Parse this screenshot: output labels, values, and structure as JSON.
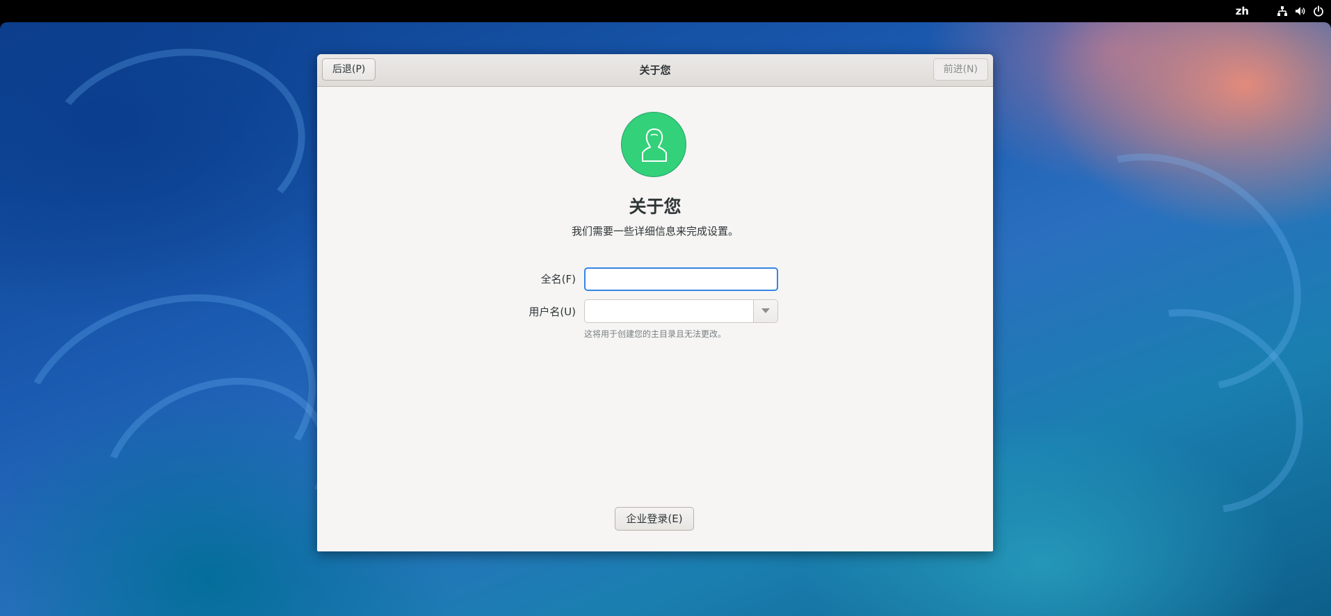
{
  "topbar": {
    "language": "zh",
    "icons": [
      "network-wired-icon",
      "speaker-volume-icon",
      "power-icon"
    ]
  },
  "dialog": {
    "title": "关于您",
    "back_label": "后退(P)",
    "next_label": "前进(N)",
    "avatar_icon": "user-avatar-icon",
    "avatar_color": "#33d17a",
    "heading": "关于您",
    "subheading": "我们需要一些详细信息来完成设置。",
    "fullname": {
      "label": "全名(F)",
      "value": ""
    },
    "username": {
      "label": "用户名(U)",
      "value": "",
      "hint": "这将用于创建您的主目录且无法更改。"
    },
    "enterprise_label": "企业登录(E)"
  },
  "colors": {
    "focus_accent": "#3584e4",
    "text": "#2e3436"
  }
}
